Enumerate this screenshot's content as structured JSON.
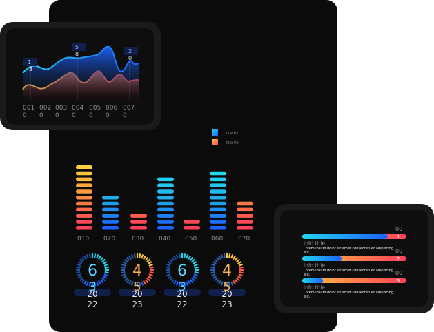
{
  "colors": {
    "panel": "#0b0b0b",
    "label": "#8a8a8a",
    "cyan": "#22d3ee",
    "blue": "#1d63ff",
    "yellow": "#ffc43d",
    "orange": "#ff8a3d",
    "red": "#ff3f5a",
    "tag_bg": "#10204a"
  },
  "area_chart": {
    "callouts": [
      {
        "top": "1",
        "bottom": "3"
      },
      {
        "top": "5",
        "bottom": "8"
      },
      {
        "top": "2",
        "bottom": "0"
      }
    ],
    "x_labels": [
      {
        "top": "001",
        "bottom": "0"
      },
      {
        "top": "002",
        "bottom": "0"
      },
      {
        "top": "003",
        "bottom": "0"
      },
      {
        "top": "004",
        "bottom": "0"
      },
      {
        "top": "005",
        "bottom": "0"
      },
      {
        "top": "006",
        "bottom": "0"
      },
      {
        "top": "007",
        "bottom": "0"
      }
    ]
  },
  "legend": [
    {
      "label": "title 01",
      "color_from": "#22d3ee",
      "color_to": "#1d63ff"
    },
    {
      "label": "title 02",
      "color_from": "#ffc43d",
      "color_to": "#ff3f5a"
    }
  ],
  "chart_data": {
    "type": "bar",
    "categories": [
      "010",
      "020",
      "030",
      "040",
      "050",
      "060",
      "070"
    ],
    "series": [
      {
        "values": [
          11,
          6,
          0,
          0,
          0,
          0,
          0
        ]
      },
      {
        "values": [
          0,
          0,
          3,
          9,
          2,
          10,
          5
        ]
      }
    ],
    "stack_palettes": [
      "warm",
      "cool",
      "warm",
      "cool",
      "warm",
      "cool",
      "warm"
    ],
    "segments": [
      11,
      6,
      3,
      9,
      2,
      10,
      5
    ]
  },
  "gauges": [
    {
      "number": "6",
      "sub": "3",
      "caption_top": "20",
      "caption_bottom": "22",
      "style": "cool",
      "fill": 0.6
    },
    {
      "number": "4",
      "sub": "5",
      "caption_top": "20",
      "caption_bottom": "23",
      "style": "warm",
      "fill": 0.45
    },
    {
      "number": "6",
      "sub": "3",
      "caption_top": "20",
      "caption_bottom": "22",
      "style": "cool",
      "fill": 0.6
    },
    {
      "number": "4",
      "sub": "5",
      "caption_top": "20",
      "caption_bottom": "23",
      "style": "warm",
      "fill": 0.45
    }
  ],
  "info_rows": [
    {
      "value_top": "00",
      "value_bottom": "1",
      "title": "info title",
      "text": "Lorem ipsum dolor sit amet consectetuer adipiscing elit,",
      "progress": 0.82
    },
    {
      "value_top": "00",
      "value_bottom": "2",
      "title": "info title",
      "text": "Lorem ipsum dolor sit amet consectetuer adipiscing elit,",
      "progress": 0.38
    },
    {
      "value_top": "00",
      "value_bottom": "3",
      "title": "info title",
      "text": "Lorem ipsum dolor sit amet consectetuer adipiscing elit,",
      "progress": 0.2
    }
  ]
}
